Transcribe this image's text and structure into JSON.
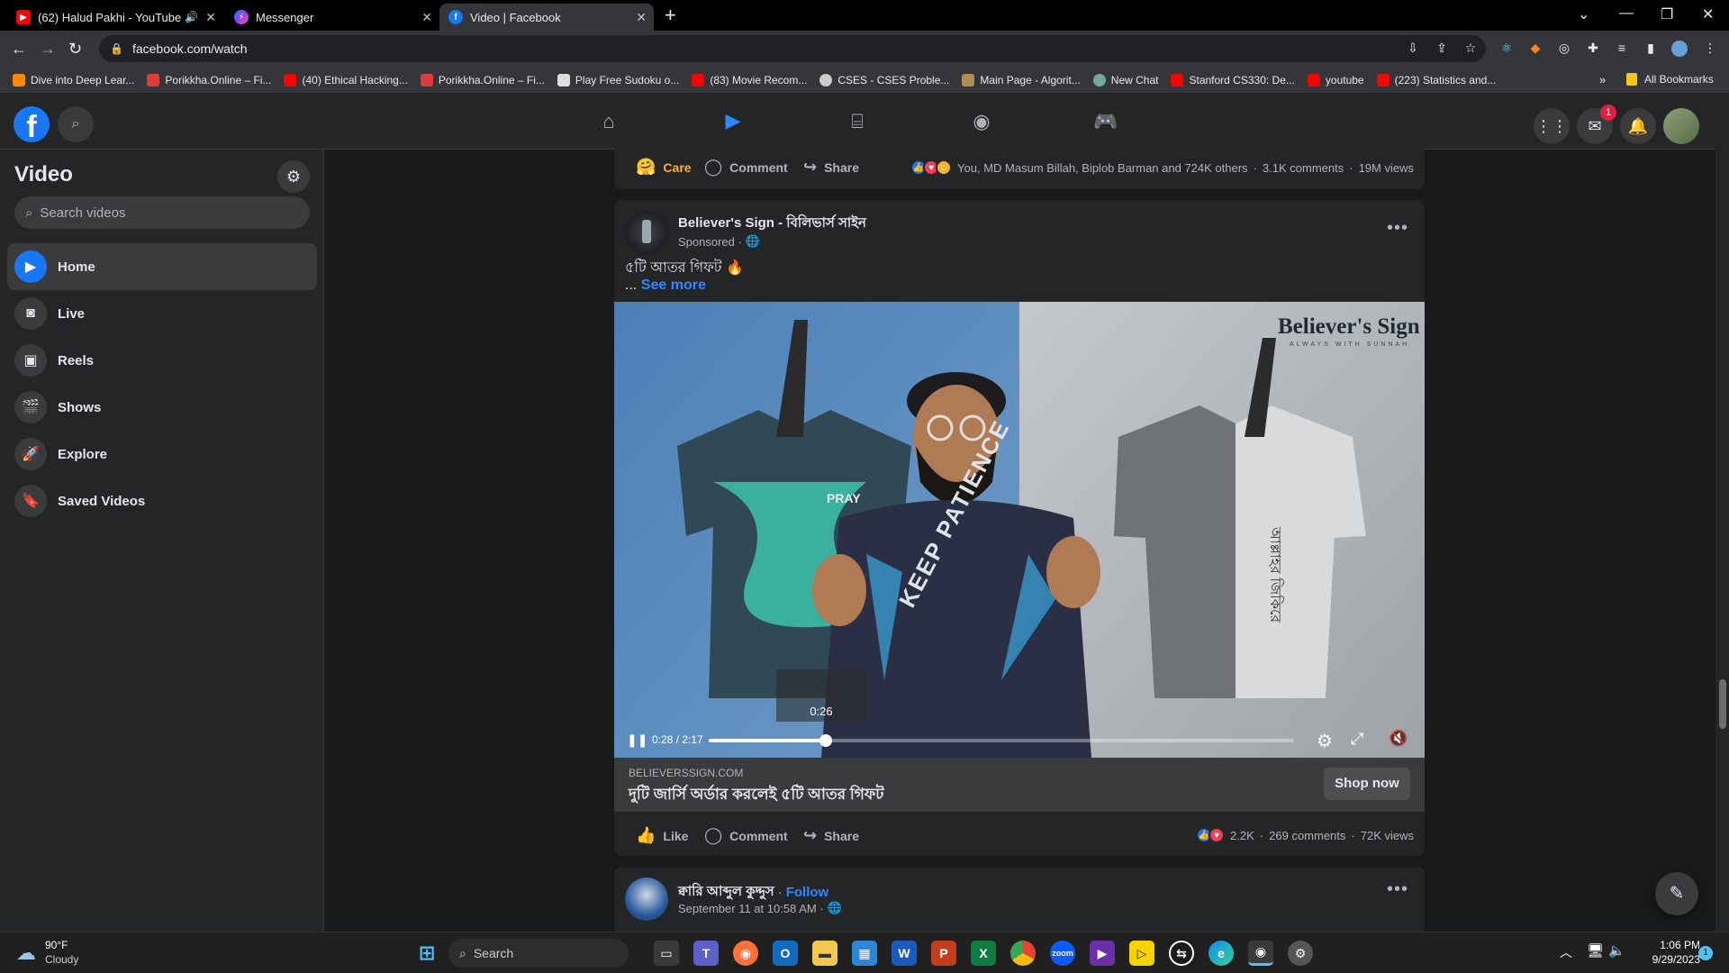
{
  "browser": {
    "tabs": [
      {
        "label": "(62) Halud Pakhi - YouTube",
        "icon": "youtube-icon",
        "active": false
      },
      {
        "label": "Messenger",
        "icon": "messenger-icon",
        "active": false
      },
      {
        "label": "Video | Facebook",
        "icon": "facebook-icon",
        "active": true
      }
    ],
    "new_tab": "+",
    "url": "facebook.com/watch",
    "bookmarks": [
      "Dive into Deep Lear...",
      "Porikkha.Online – Fi...",
      "(40) Ethical Hacking...",
      "Porikkha.Online – Fi...",
      "Play Free Sudoku o...",
      "(83) Movie Recom...",
      "CSES - CSES Proble...",
      "Main Page - Algorit...",
      "New Chat",
      "Stanford CS330: De...",
      "youtube",
      "(223) Statistics and..."
    ],
    "bookmarks_overflow": "»",
    "all_bookmarks": "All Bookmarks"
  },
  "fbnav": {
    "logo": "f",
    "messenger_badge": "1"
  },
  "sidebar": {
    "title": "Video",
    "search_placeholder": "Search videos",
    "items": [
      {
        "label": "Home",
        "icon": "play-icon"
      },
      {
        "label": "Live",
        "icon": "live-camera-icon"
      },
      {
        "label": "Reels",
        "icon": "reels-icon"
      },
      {
        "label": "Shows",
        "icon": "clapper-icon"
      },
      {
        "label": "Explore",
        "icon": "rocket-icon"
      },
      {
        "label": "Saved Videos",
        "icon": "bookmark-icon"
      }
    ]
  },
  "post1": {
    "reaction_label": "Care",
    "comment_label": "Comment",
    "share_label": "Share",
    "reactions_text": "You, MD Masum Billah, Biplob Barman and 724K others",
    "comments_count": "3.1K comments",
    "views_count": "19M views"
  },
  "post2": {
    "author": "Believer's Sign - বিলিভার্স সাইন",
    "meta": "Sponsored ·",
    "caption": "৫টি আতর গিফট",
    "ellipsis": "...",
    "see_more": "See more",
    "video": {
      "brand_logo": "Believer's Sign",
      "brand_tagline": "ALWAYS WITH SUNNAH",
      "shirt_left_text": "PRAY",
      "shirt_center_text": "KEEP PATIENCE",
      "shirt_right_text": "আল্লাহর জিকিরে",
      "hover_time": "0:26",
      "current_time": "0:28",
      "duration": "2:17",
      "progress": 0.2
    },
    "link_domain": "BELIEVERSSIGN.COM",
    "link_title": "দুটি জার্সি অর্ডার করলেই ৫টি আতর গিফট",
    "cta": "Shop now",
    "like_label": "Like",
    "comment_label": "Comment",
    "share_label": "Share",
    "reactions_count": "2.2K",
    "comments_count": "269 comments",
    "views_count": "72K views"
  },
  "post3": {
    "author": "ক্বারি আব্দুল কুদ্দুস",
    "dot": "·",
    "follow": "Follow",
    "meta": "September 11 at 10:58 AM ·"
  },
  "taskbar": {
    "weather_temp": "90°F",
    "weather_desc": "Cloudy",
    "search_placeholder": "Search",
    "time": "1:06 PM",
    "date": "9/29/2023",
    "notif_count": "1"
  },
  "colors": {
    "fb_blue": "#1877f2",
    "bg": "#18191a",
    "surface": "#242526",
    "accent_link": "#2d88ff"
  }
}
